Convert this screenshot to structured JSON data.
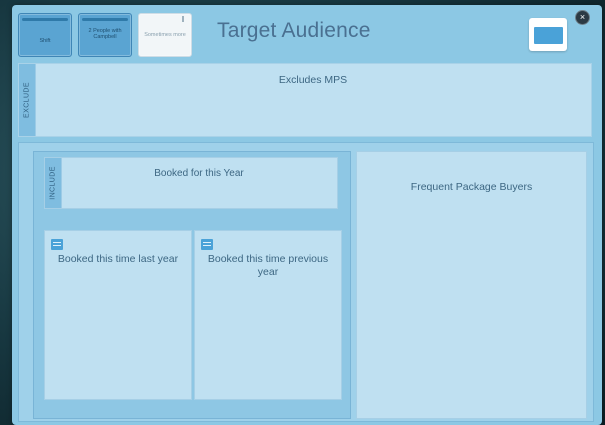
{
  "header": {
    "title": "Target Audience",
    "tiles": [
      {
        "label": "Shift"
      },
      {
        "label": "2 People with Campbell"
      },
      {
        "label": "Sometimes more"
      }
    ],
    "display_icon": "monitor-icon",
    "close_icon": "close-icon",
    "close_glyph": "×"
  },
  "exclude": {
    "tag": "EXCLUDE",
    "label": "Excludes MPS"
  },
  "include_group": {
    "tag": "INCLUDE",
    "label": "Booked for this Year",
    "cards": [
      {
        "icon": "calendar-icon",
        "label": "Booked this time last year"
      },
      {
        "icon": "calendar-icon",
        "label": "Booked this time previous year"
      }
    ]
  },
  "frequent": {
    "label": "Frequent Package Buyers"
  },
  "colors": {
    "panel": "#8cc8e4",
    "tile": "#5aa4d2",
    "card": "#bfe0f1",
    "accent": "#4aa2d8"
  }
}
